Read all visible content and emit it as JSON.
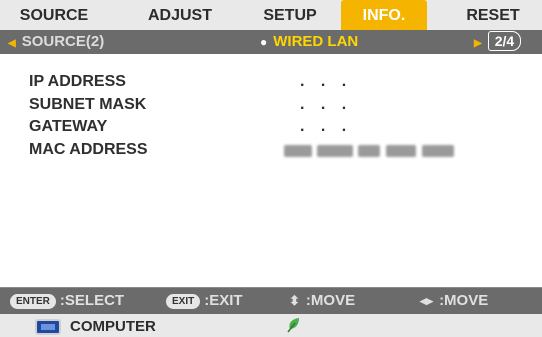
{
  "tabs": [
    {
      "label": "SOURCE"
    },
    {
      "label": "ADJUST"
    },
    {
      "label": "SETUP"
    },
    {
      "label": "INFO."
    },
    {
      "label": "RESET"
    }
  ],
  "subheader": {
    "left": "SOURCE(2)",
    "center": "WIRED LAN",
    "page": "2/4"
  },
  "fields": [
    {
      "label": "IP ADDRESS",
      "value": ". . ."
    },
    {
      "label": "SUBNET MASK",
      "value": ". . ."
    },
    {
      "label": "GATEWAY",
      "value": ". . ."
    },
    {
      "label": "MAC ADDRESS",
      "value": ""
    }
  ],
  "footer": {
    "enter_key": "ENTER",
    "enter_label": ":SELECT",
    "exit_key": "EXIT",
    "exit_label": ":EXIT",
    "updown_label": ":MOVE",
    "leftright_label": ":MOVE"
  },
  "status": {
    "source": "COMPUTER",
    "icon": "monitor-icon",
    "eco_icon": "leaf-icon"
  },
  "colors": {
    "active_tab": "#f4b400",
    "subheader_bg": "#6b6b6b",
    "highlight_text": "#ffd600",
    "leaf": "#4cae4c"
  }
}
